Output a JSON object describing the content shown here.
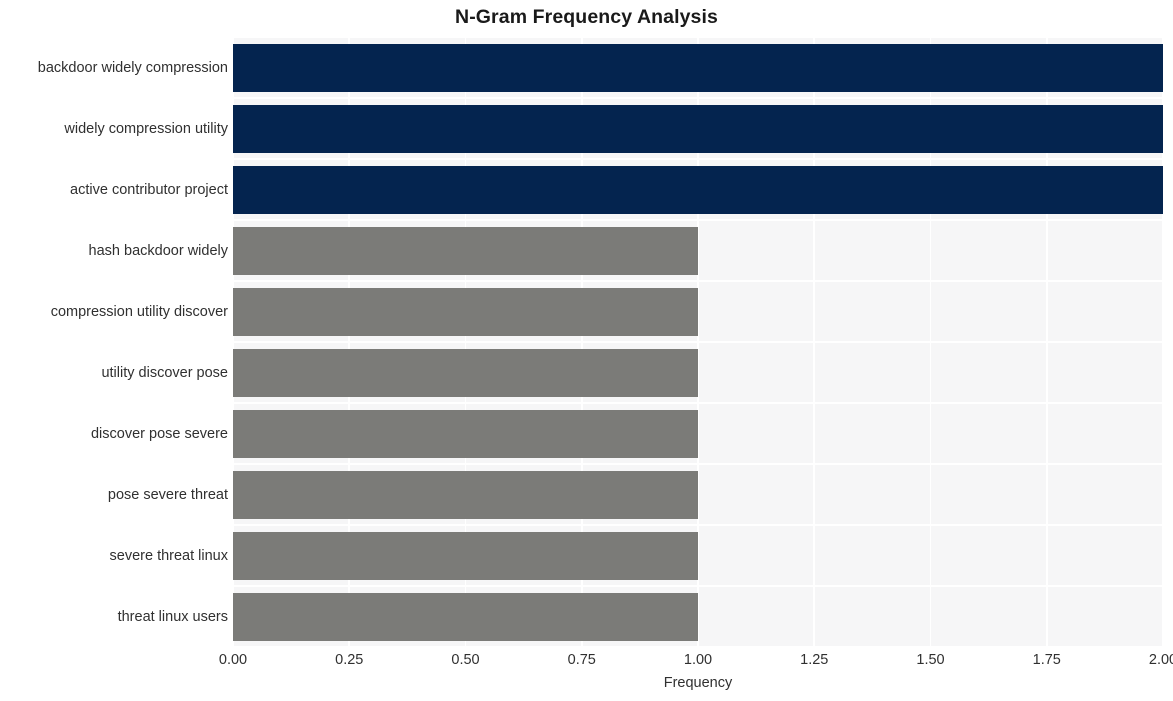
{
  "chart_data": {
    "type": "bar",
    "orientation": "horizontal",
    "title": "N-Gram Frequency Analysis",
    "xlabel": "Frequency",
    "ylabel": "",
    "categories": [
      "backdoor widely compression",
      "widely compression utility",
      "active contributor project",
      "hash backdoor widely",
      "compression utility discover",
      "utility discover pose",
      "discover pose severe",
      "pose severe threat",
      "severe threat linux",
      "threat linux users"
    ],
    "values": [
      2,
      2,
      2,
      1,
      1,
      1,
      1,
      1,
      1,
      1
    ],
    "bar_colors": [
      "#04244f",
      "#04244f",
      "#04244f",
      "#7b7b78",
      "#7b7b78",
      "#7b7b78",
      "#7b7b78",
      "#7b7b78",
      "#7b7b78",
      "#7b7b78"
    ],
    "xlim": [
      0,
      2
    ],
    "xticks": [
      0,
      0.25,
      0.5,
      0.75,
      1,
      1.25,
      1.5,
      1.75,
      2
    ],
    "xtick_labels": [
      "0.00",
      "0.25",
      "0.50",
      "0.75",
      "1.00",
      "1.25",
      "1.50",
      "1.75",
      "2.00"
    ],
    "grid": true,
    "legend": null,
    "colors": {
      "highlight": "#04244f",
      "normal": "#7b7b78",
      "plot_background": "#f6f6f7",
      "figure_background": "#ffffff",
      "gridline": "#ffffff",
      "text": "#303030",
      "title_text": "#1a1a1a"
    }
  }
}
